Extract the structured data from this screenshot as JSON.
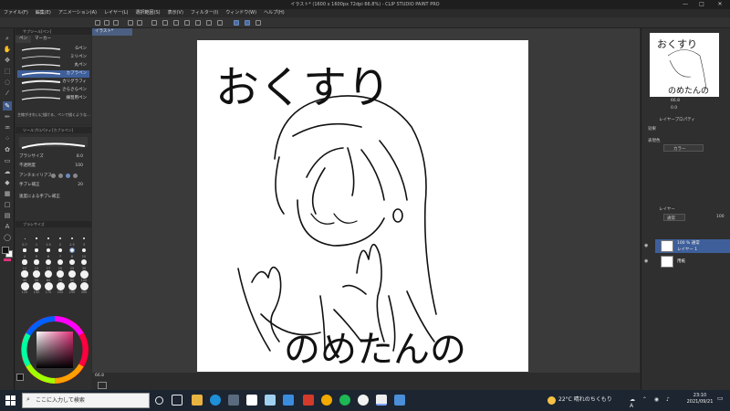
{
  "window": {
    "title": "イラスト* (1600 x 1600px 72dpi 66.8%) - CLIP STUDIO PAINT PRO",
    "minimize": "—",
    "maximize": "□",
    "close": "✕"
  },
  "menu": [
    "ファイル(F)",
    "編集(E)",
    "アニメーション(A)",
    "レイヤー(L)",
    "選択範囲(S)",
    "表示(V)",
    "フィルター(I)",
    "ウィンドウ(W)",
    "ヘルプ(H)"
  ],
  "document_tab": "イラスト*",
  "subtool": {
    "header": "サブツール[ペン]",
    "tabs": [
      "ペン",
      "マーカー"
    ],
    "brushes": [
      "Gペン",
      "ミリペン",
      "丸ペン",
      "カブラペン",
      "カリグラフィ",
      "さらさらペン",
      "練習用ペン"
    ],
    "selected_index": 3,
    "footer": "主線がきれいに描ける、ペンで描くような..."
  },
  "tool_property": {
    "header": "ツールプロパティ[カブラペン]",
    "rows": [
      {
        "label": "ブラシサイズ",
        "value": "8.0"
      },
      {
        "label": "不透明度",
        "value": "100"
      },
      {
        "label": "アンチエイリアス",
        "value": ""
      },
      {
        "label": "手ブレ補正",
        "value": "20"
      },
      {
        "label": "速度による手ブレ補正",
        "value": ""
      }
    ]
  },
  "brush_size": {
    "header": "ブラシサイズ",
    "sizes": [
      "0.7",
      "1",
      "1.5",
      "2",
      "2.5",
      "3",
      "4",
      "5",
      "6",
      "7",
      "8",
      "10",
      "12",
      "15",
      "17",
      "20",
      "25",
      "30",
      "40",
      "50",
      "60",
      "70",
      "80",
      "100",
      "120",
      "150",
      "170",
      "200",
      "250",
      "300"
    ]
  },
  "color": {
    "main": "#111111",
    "sub": "#ffffff",
    "accent": "#e0307a"
  },
  "canvas": {
    "zoom": "66.8",
    "text_top": "おくすり",
    "text_bottom": "のめたんの"
  },
  "right_panel": {
    "navigator_zoom": "66.8",
    "navigator_angle": "0.0",
    "layer_property_header": "レイヤープロパティ",
    "effect_label": "効果",
    "express_label": "表現色",
    "express_value": "カラー",
    "layer_header": "レイヤー",
    "blend_mode": "通常",
    "opacity": "100",
    "layers": [
      {
        "line1": "100 % 通常",
        "line2": "レイヤー 1",
        "selected": true
      },
      {
        "line1": "用紙",
        "line2": "",
        "selected": false
      }
    ]
  },
  "taskbar": {
    "search_placeholder": "ここに入力して検索",
    "weather": "22°C 晴れのちくもり",
    "time": "23:10",
    "date": "2021/09/21"
  }
}
